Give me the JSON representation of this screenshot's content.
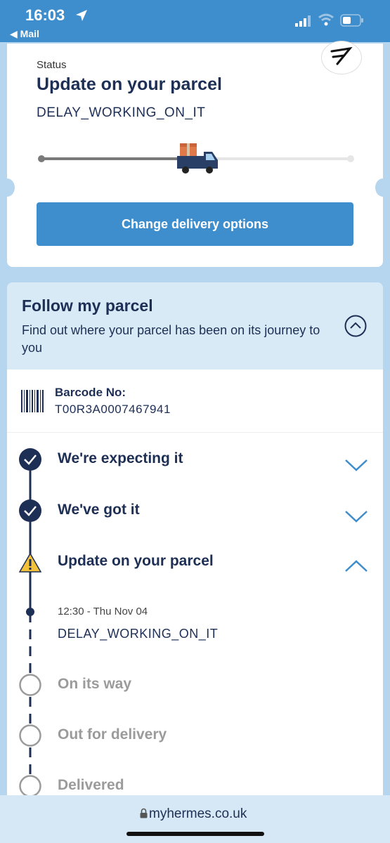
{
  "statusbar": {
    "time": "16:03",
    "back_label": "◀ Mail"
  },
  "status_card": {
    "label": "Status",
    "title": "Update on your parcel",
    "code": "DELAY_WORKING_ON_IT",
    "progress": 0.5,
    "button_label": "Change delivery options"
  },
  "follow": {
    "title": "Follow my parcel",
    "description": "Find out where your parcel has been on its journey to you",
    "barcode_label": "Barcode No:",
    "barcode_value": "T00R3A0007467941"
  },
  "timeline": {
    "steps": [
      {
        "label": "We're expecting it",
        "state": "done"
      },
      {
        "label": "We've got it",
        "state": "done"
      },
      {
        "label": "Update on your parcel",
        "state": "warning"
      },
      {
        "label": "On its way",
        "state": "pending"
      },
      {
        "label": "Out for delivery",
        "state": "pending"
      },
      {
        "label": "Delivered",
        "state": "pending"
      }
    ],
    "event": {
      "time": "12:30 - Thu Nov 04",
      "status": "DELAY_WORKING_ON_IT"
    }
  },
  "browser": {
    "url": "myhermes.co.uk"
  },
  "colors": {
    "brand_blue": "#3e8dcc",
    "navy": "#1e2f55",
    "warning": "#f3c13a",
    "muted": "#9b9b9b"
  }
}
